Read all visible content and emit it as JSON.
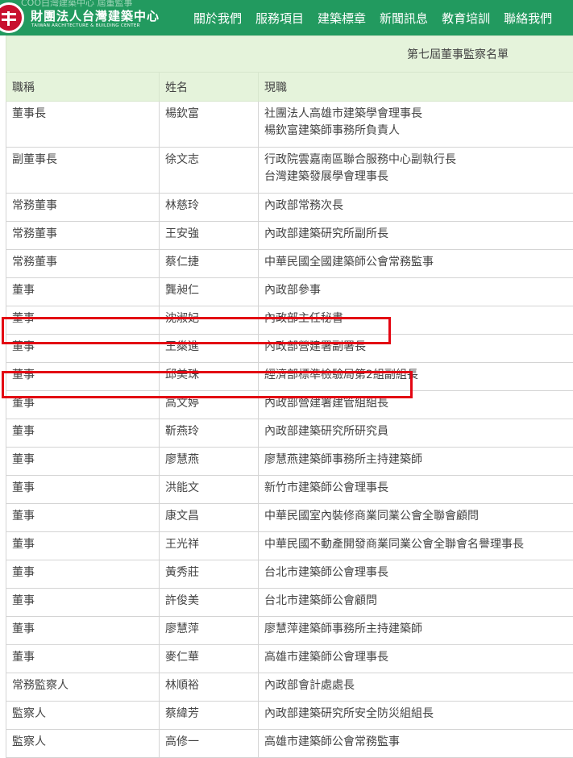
{
  "header": {
    "ghost_text": "COO白灣建築中心 屆董監事",
    "org_name": "財團法人台灣建築中心",
    "org_name_en": "TAIWAN ARCHITECTURE & BUILDING CENTER",
    "nav": [
      "關於我們",
      "服務項目",
      "建築標章",
      "新聞訊息",
      "教育培訓",
      "聯絡我們"
    ]
  },
  "table": {
    "title": "第七屆董事監察名單",
    "columns": [
      "職稱",
      "姓名",
      "現職"
    ],
    "rows": [
      {
        "role": "董事長",
        "name": "楊欽富",
        "position": [
          "社團法人高雄市建築學會理事長",
          "楊欽富建築師事務所負責人"
        ]
      },
      {
        "role": "副董事長",
        "name": "徐文志",
        "position": [
          "行政院雲嘉南區聯合服務中心副執行長",
          "台灣建築發展學會理事長"
        ]
      },
      {
        "role": "常務董事",
        "name": "林慈玲",
        "position": [
          "內政部常務次長"
        ]
      },
      {
        "role": "常務董事",
        "name": "王安強",
        "position": [
          "內政部建築研究所副所長"
        ]
      },
      {
        "role": "常務董事",
        "name": "蔡仁捷",
        "position": [
          "中華民國全國建築師公會常務監事"
        ]
      },
      {
        "role": "董事",
        "name": "龔昶仁",
        "position": [
          "內政部參事"
        ]
      },
      {
        "role": "董事",
        "name": "沈淑妃",
        "position": [
          "內政部主任秘書"
        ]
      },
      {
        "role": "董事",
        "name": "王燊進",
        "position": [
          "內政部營建署副署長"
        ]
      },
      {
        "role": "董事",
        "name": "邱美珠",
        "position": [
          "經濟部標準檢驗局第2組副組長"
        ]
      },
      {
        "role": "董事",
        "name": "高文婷",
        "position": [
          "內政部營建署建管組組長"
        ]
      },
      {
        "role": "董事",
        "name": "靳燕玲",
        "position": [
          "內政部建築研究所研究員"
        ]
      },
      {
        "role": "董事",
        "name": "廖慧燕",
        "position": [
          "廖慧燕建築師事務所主持建築師"
        ]
      },
      {
        "role": "董事",
        "name": "洪能文",
        "position": [
          "新竹市建築師公會理事長"
        ]
      },
      {
        "role": "董事",
        "name": "康文昌",
        "position": [
          "中華民國室內裝修商業同業公會全聯會顧問"
        ]
      },
      {
        "role": "董事",
        "name": "王光祥",
        "position": [
          "中華民國不動產開發商業同業公會全聯會名譽理事長"
        ]
      },
      {
        "role": "董事",
        "name": "黃秀莊",
        "position": [
          "台北市建築師公會理事長"
        ]
      },
      {
        "role": "董事",
        "name": "許俊美",
        "position": [
          "台北市建築師公會顧問"
        ]
      },
      {
        "role": "董事",
        "name": "廖慧萍",
        "position": [
          "廖慧萍建築師事務所主持建築師"
        ]
      },
      {
        "role": "董事",
        "name": "麥仁華",
        "position": [
          "高雄市建築師公會理事長"
        ]
      },
      {
        "role": "常務監察人",
        "name": "林順裕",
        "position": [
          "內政部會計處處長"
        ]
      },
      {
        "role": "監察人",
        "name": "蔡緯芳",
        "position": [
          "內政部建築研究所安全防災組組長"
        ]
      },
      {
        "role": "監察人",
        "name": "高修一",
        "position": [
          "高雄市建築師公會常務監事"
        ]
      }
    ]
  },
  "highlight_color": "#e30613",
  "theme_color": "#229a5f"
}
